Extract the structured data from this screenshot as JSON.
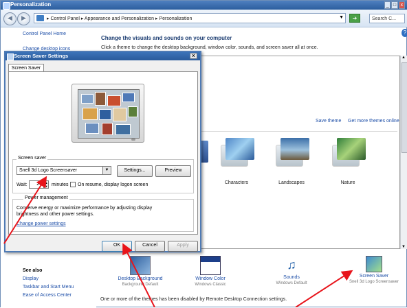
{
  "window": {
    "title": "Personalization",
    "controls": {
      "minimize": "_",
      "maximize": "□",
      "close": "x"
    }
  },
  "address_bar": {
    "crumbs": "▸ Control Panel ▸ Appearance and Personalization ▸ Personalization",
    "search_placeholder": "Search C..."
  },
  "left_pane": {
    "control_panel_home": "Control Panel Home",
    "change_desktop_icons": "Change desktop icons"
  },
  "main": {
    "heading": "Change the visuals and sounds on your computer",
    "subtext": "Click a theme to change the desktop background, window color, sounds, and screen saver all at once.",
    "save_theme": "Save theme",
    "get_more_themes": "Get more themes online",
    "themes": [
      {
        "label": "Characters"
      },
      {
        "label": "Landscapes"
      },
      {
        "label": "Nature"
      }
    ]
  },
  "see_also": {
    "title": "See also",
    "items": [
      "Display",
      "Taskbar and Start Menu",
      "Ease of Access Center"
    ]
  },
  "bottom_items": [
    {
      "label": "Desktop Background",
      "sub": "Background Default"
    },
    {
      "label": "Window Color",
      "sub": "Windows Classic"
    },
    {
      "label": "Sounds",
      "sub": "Windows Default"
    },
    {
      "label": "Screen Saver",
      "sub": "Snell 3d Logo Screensaver"
    }
  ],
  "warning": "One or more of the themes has been disabled by Remote Desktop Connection settings.",
  "dialog": {
    "title": "Screen Saver Settings",
    "close": "x",
    "tab": "Screen Saver",
    "screen_saver_legend": "Screen saver",
    "screen_saver_value": "Snell 3d Logo Screensaver",
    "settings_button": "Settings...",
    "preview_button": "Preview",
    "wait_label": "Wait:",
    "wait_value": "20",
    "minutes_label": "minutes",
    "resume_label": "On resume, display logon screen",
    "power_legend": "Power management",
    "power_text1": "Conserve energy or maximize performance by adjusting display",
    "power_text2": "brightness and other power settings.",
    "power_link": "Change power settings",
    "ok": "OK",
    "cancel": "Cancel",
    "apply": "Apply"
  },
  "colors": {
    "link": "#1e4fa8",
    "title_bar": "#2c5e9e",
    "annotation_arrow": "#e8141b"
  }
}
